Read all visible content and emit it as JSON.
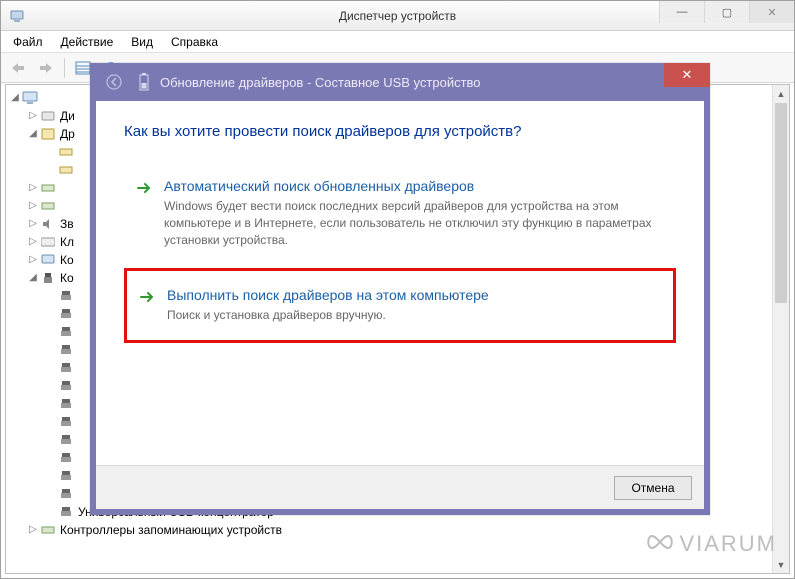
{
  "main_window": {
    "title": "Диспетчер устройств",
    "menu": {
      "file": "Файл",
      "action": "Действие",
      "view": "Вид",
      "help": "Справка"
    },
    "tree": {
      "root": "",
      "nodes": [
        {
          "label": "Ди",
          "expander": "▷"
        },
        {
          "label": "Др",
          "expander": "◢"
        },
        {
          "label": "",
          "expander": "▷"
        },
        {
          "label": "",
          "expander": "▷"
        },
        {
          "label": "Зв",
          "expander": "▷"
        },
        {
          "label": "Кл",
          "expander": "▷"
        },
        {
          "label": "Ко",
          "expander": "▷"
        },
        {
          "label": "Ко",
          "expander": "◢"
        }
      ],
      "bottom_nodes": [
        {
          "label": "Универсальный USB-концентратор",
          "expander": ""
        },
        {
          "label": "Контроллеры запоминающих устройств",
          "expander": "▷"
        }
      ]
    }
  },
  "dialog": {
    "title": "Обновление драйверов - Составное USB устройство",
    "heading": "Как вы хотите провести поиск драйверов для устройств?",
    "option1": {
      "title": "Автоматический поиск обновленных драйверов",
      "desc": "Windows будет вести поиск последних версий драйверов для устройства на этом компьютере и в Интернете, если пользователь не отключил эту функцию в параметрах установки устройства."
    },
    "option2": {
      "title": "Выполнить поиск драйверов на этом компьютере",
      "desc": "Поиск и установка драйверов вручную."
    },
    "cancel": "Отмена"
  },
  "watermark": "VIARUM"
}
